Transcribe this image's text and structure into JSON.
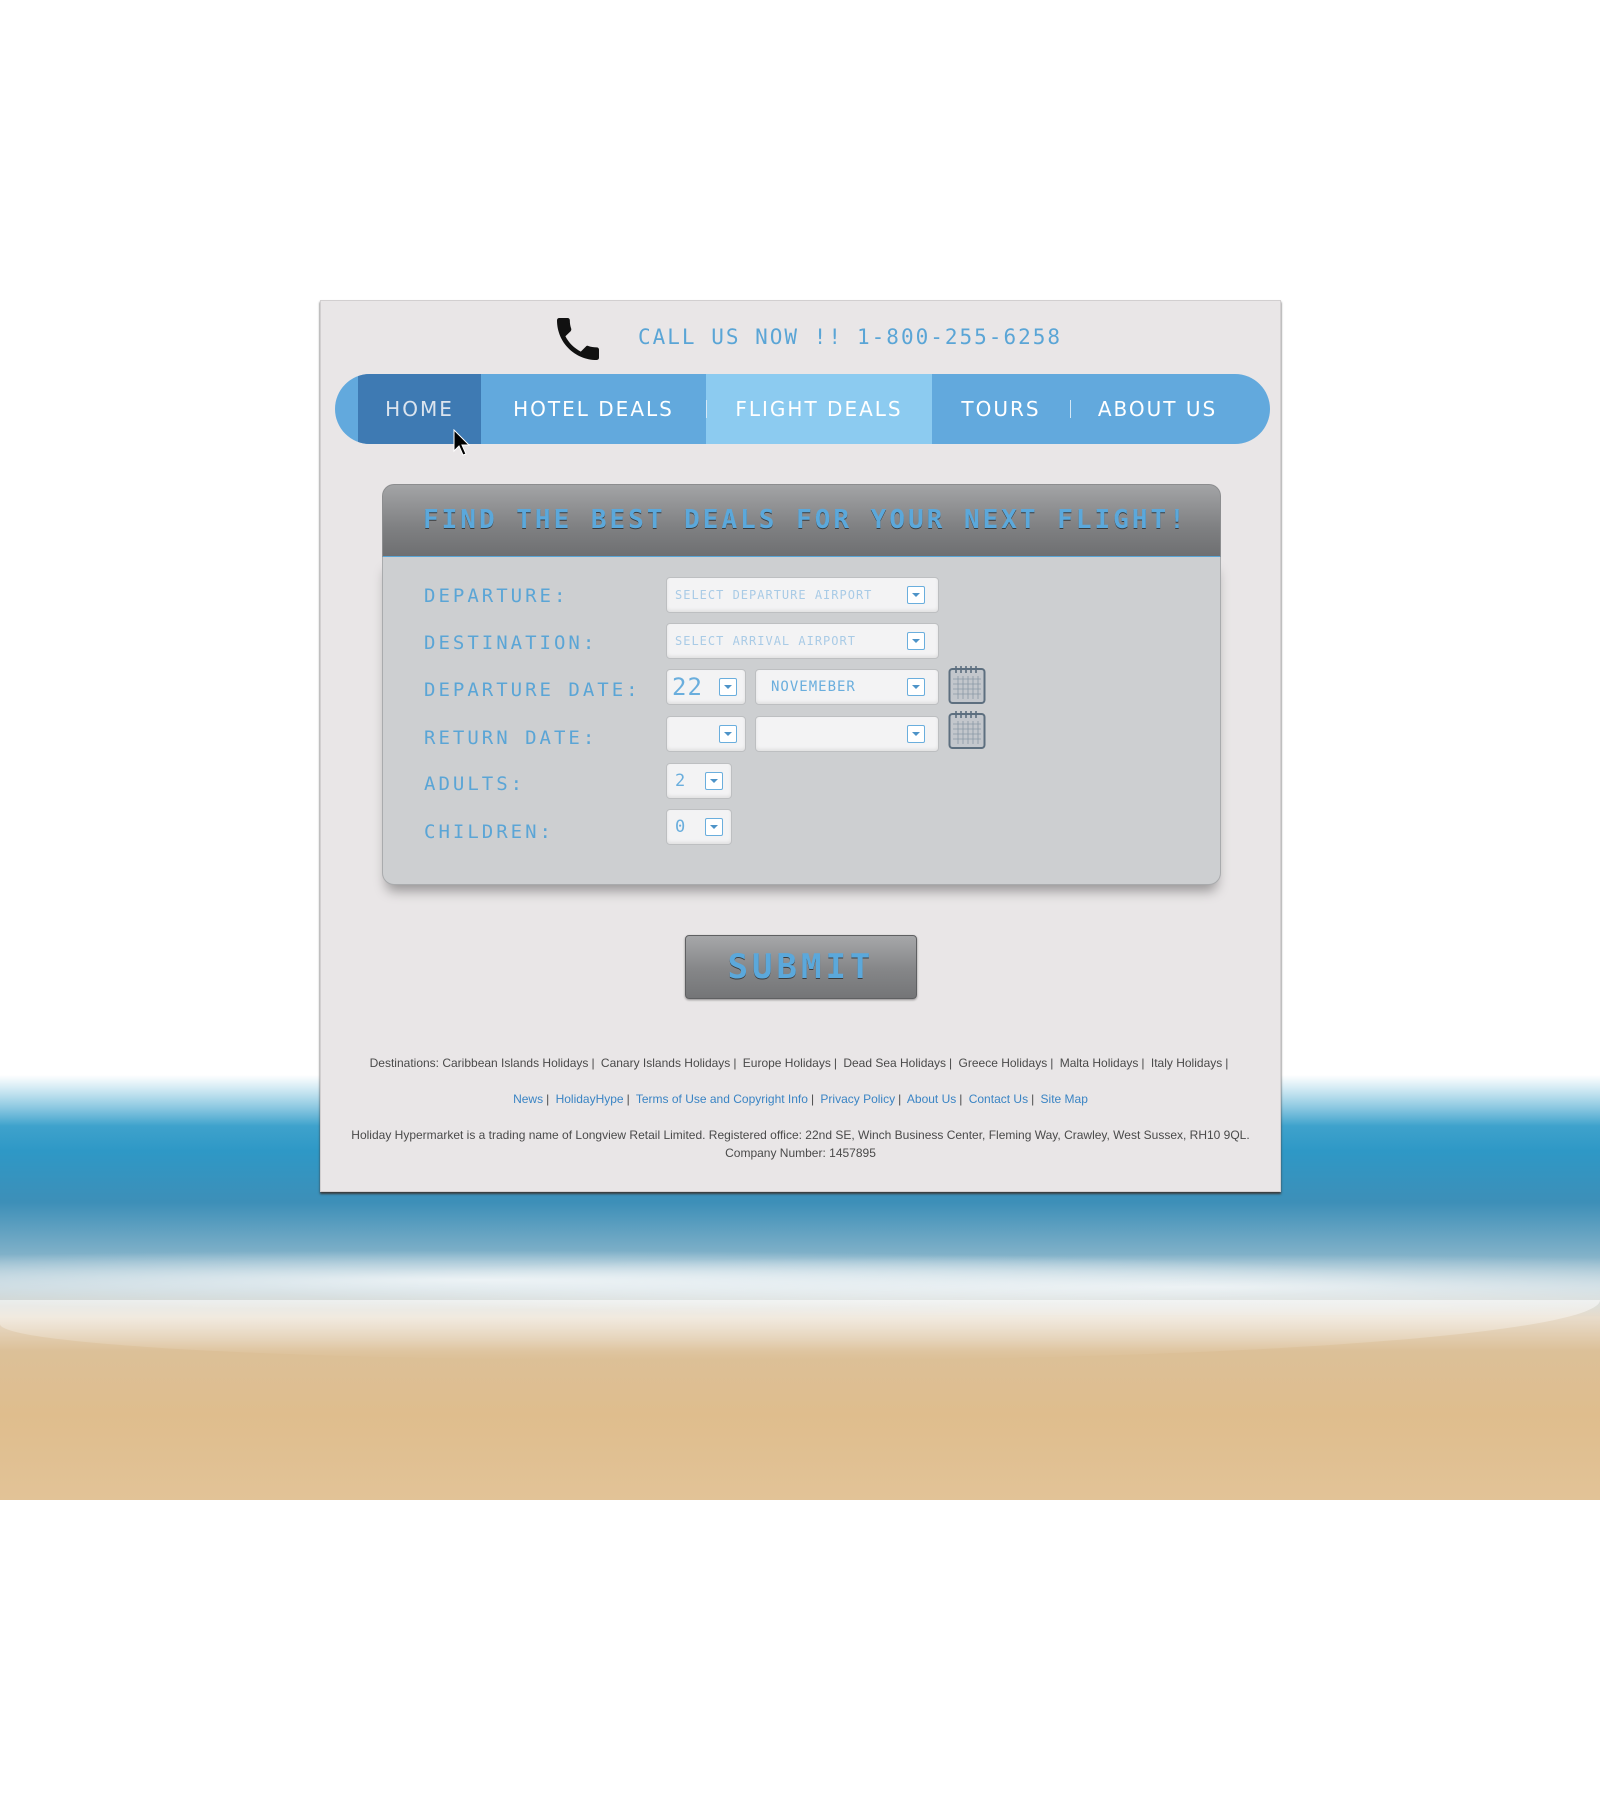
{
  "header": {
    "call_text": "CALL US NOW !!",
    "phone_number": "1-800-255-6258"
  },
  "nav": {
    "items": [
      {
        "label": "HOME"
      },
      {
        "label": "HOTEL DEALS"
      },
      {
        "label": "FLIGHT DEALS"
      },
      {
        "label": "TOURS"
      },
      {
        "label": "ABOUT US"
      }
    ]
  },
  "search": {
    "title": "FIND THE BEST DEALS FOR YOUR NEXT FLIGHT!",
    "departure": {
      "label": "DEPARTURE:",
      "placeholder": "SELECT DEPARTURE AIRPORT"
    },
    "destination": {
      "label": "DESTINATION:",
      "placeholder": "SELECT ARRIVAL AIRPORT"
    },
    "departure_date": {
      "label": "DEPARTURE DATE:",
      "day": "22",
      "month": "NOVEMEBER"
    },
    "return_date": {
      "label": "RETURN DATE:",
      "day": "",
      "month": ""
    },
    "adults": {
      "label": "ADULTS:",
      "value": "2"
    },
    "children": {
      "label": "CHILDREN:",
      "value": "0"
    }
  },
  "submit_label": "SUBMIT",
  "footer": {
    "destinations_prefix": "Destinations:",
    "destinations": [
      "Caribbean Islands Holidays",
      "Canary Islands Holidays",
      "Europe Holidays",
      "Dead Sea Holidays",
      "Greece Holidays",
      "Malta Holidays",
      "Italy Holidays"
    ],
    "links": [
      "News",
      "HolidayHype",
      "Terms of Use and Copyright Info",
      "Privacy Policy",
      "About Us",
      "Contact Us",
      "Site Map"
    ],
    "legal_line1": "Holiday Hypermarket is a trading name of Longview Retail Limited. Registered office: 22nd SE, Winch Business Center, Fleming Way, Crawley, West Sussex, RH10 9QL.",
    "legal_line2": "Company Number: 1457895"
  },
  "colors": {
    "accent": "#5aa5d6",
    "nav_bg": "#62a9dd",
    "nav_active": "#3e7ab3",
    "nav_highlight": "#8ccbf0",
    "panel_bg": "#e9e6e7"
  }
}
